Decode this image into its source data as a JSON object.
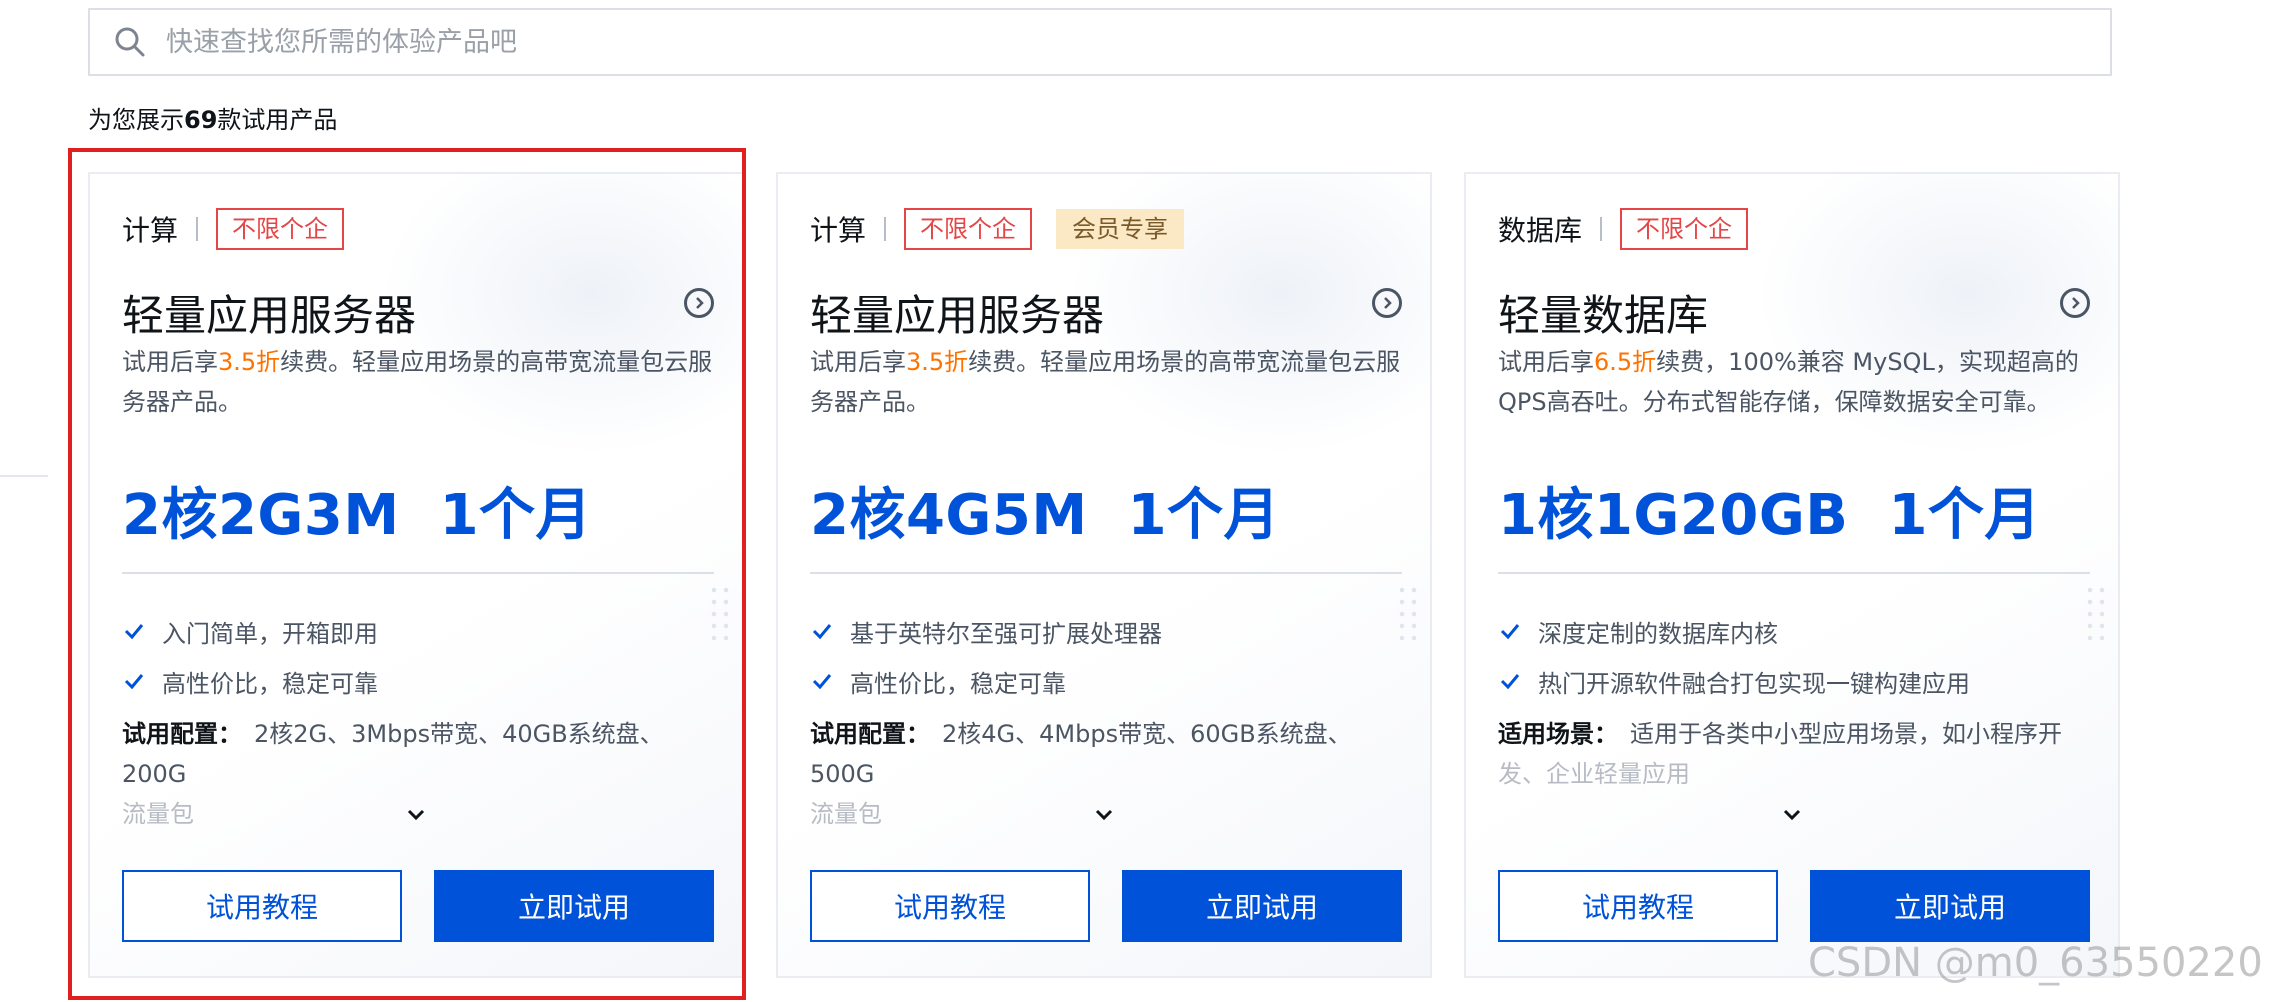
{
  "search": {
    "placeholder": "快速查找您所需的体验产品吧"
  },
  "count": {
    "prefix": "为您展示",
    "number": "69",
    "suffix": "款试用产品"
  },
  "cards": [
    {
      "category": "计算",
      "tag": "不限个企",
      "title": "轻量应用服务器",
      "desc_prefix": "试用后享",
      "desc_highlight": "3.5折",
      "desc_rest": "续费。轻量应用场景的高带宽流量包云服务器产品。",
      "spec": "2核2G3M  1个月",
      "features": [
        "入门简单，开箱即用",
        "高性价比，稳定可靠"
      ],
      "config_label": "试用配置：",
      "config_text": "2核2G、3Mbps带宽、40GB系统盘、200G",
      "config_fade": "流量包",
      "btn_tutorial": "试用教程",
      "btn_try": "立即试用"
    },
    {
      "category": "计算",
      "tag": "不限个企",
      "tag2": "会员专享",
      "title": "轻量应用服务器",
      "desc_prefix": "试用后享",
      "desc_highlight": "3.5折",
      "desc_rest": "续费。轻量应用场景的高带宽流量包云服务器产品。",
      "spec": "2核4G5M  1个月",
      "features": [
        "基于英特尔至强可扩展处理器",
        "高性价比，稳定可靠"
      ],
      "config_label": "试用配置：",
      "config_text": "2核4G、4Mbps带宽、60GB系统盘、500G",
      "config_fade": "流量包",
      "btn_tutorial": "试用教程",
      "btn_try": "立即试用"
    },
    {
      "category": "数据库",
      "tag": "不限个企",
      "title": "轻量数据库",
      "desc_prefix": "试用后享",
      "desc_highlight": "6.5折",
      "desc_rest": "续费，100%兼容 MySQL，实现超高的QPS高吞吐。分布式智能存储，保障数据安全可靠。",
      "spec": "1核1G20GB  1个月",
      "features": [
        "深度定制的数据库内核",
        "热门开源软件融合打包实现一键构建应用"
      ],
      "config_label": "适用场景：",
      "config_text": "适用于各类中小型应用场景，如小程序开",
      "config_fade": "发、企业轻量应用",
      "btn_tutorial": "试用教程",
      "btn_try": "立即试用"
    }
  ],
  "watermark": "CSDN @m0_63550220",
  "colors": {
    "brand": "#0052d9",
    "tag_red": "#e54545",
    "highlight": "#ff7200",
    "selection_border": "#e02020"
  }
}
